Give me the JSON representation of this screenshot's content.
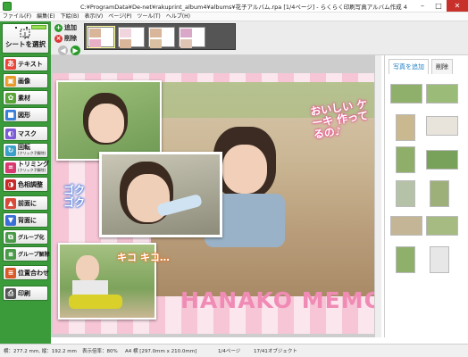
{
  "window": {
    "title": "C:¥ProgramData¥De-net¥rakuprint_album4¥albums¥花子アルバム.rpa [1/4ページ] - らくらく印刷写真アルバム作成 4",
    "controls": [
      "–",
      "□",
      "✕"
    ]
  },
  "menu": [
    "ファイル(F)",
    "編集(E)",
    "下絵(B)",
    "表示(V)",
    "ページ(P)",
    "ツール(T)",
    "ヘルプ(H)"
  ],
  "sidebar": {
    "select_label": "シートを選択",
    "tools": [
      {
        "label": "テキスト",
        "icon": "text-icon",
        "color": "#e8473a",
        "glyph": "あ"
      },
      {
        "label": "画像",
        "icon": "image-icon",
        "color": "#e89a2a",
        "glyph": "▣"
      },
      {
        "label": "素材",
        "icon": "material-icon",
        "color": "#59a53a",
        "glyph": "✿"
      },
      {
        "label": "図形",
        "icon": "shape-icon",
        "color": "#3a7fd8",
        "glyph": "■"
      },
      {
        "label": "マスク",
        "icon": "mask-icon",
        "color": "#7b5bd6",
        "glyph": "◐"
      },
      {
        "label": "回転",
        "sub": "(クリック子解除)",
        "icon": "rotate-icon",
        "color": "#3aa0c8",
        "glyph": "↻"
      },
      {
        "label": "トリミング",
        "sub": "(クリック子解除)",
        "icon": "trim-icon",
        "color": "#d83a6f",
        "glyph": "⌗"
      },
      {
        "label": "色相調整",
        "icon": "hue-icon",
        "color": "#c82a2a",
        "glyph": "◑"
      },
      {
        "label": "前面に",
        "icon": "front-icon",
        "color": "#d84a3a",
        "glyph": "▲"
      },
      {
        "label": "背面に",
        "icon": "back-icon",
        "color": "#3a6fd8",
        "glyph": "▼"
      },
      {
        "label": "グループ化",
        "icon": "group-icon",
        "color": "#4a9a4a",
        "glyph": "⧉"
      },
      {
        "label": "グループ解除",
        "icon": "ungroup-icon",
        "color": "#4a9a4a",
        "glyph": "⧈"
      },
      {
        "label": "位置合わせ",
        "icon": "align-icon",
        "color": "#d85a2a",
        "glyph": "≡"
      },
      {
        "label": "印刷",
        "icon": "print-icon",
        "color": "#555555",
        "glyph": "⎙"
      }
    ]
  },
  "toolbar": {
    "add_label": "追加",
    "delete_label": "削除"
  },
  "canvas": {
    "title_text": "HANAKO MEMORY",
    "handwritten_top": "おいしい ケーキ 作ってるの♪",
    "handwritten_left": "ゴク ゴク",
    "handwritten_bottom": "キコ キコ…"
  },
  "right_panel": {
    "tab_add": "写真を追加",
    "tab_delete": "削除"
  },
  "status": {
    "size": "横：277.2 mm, 縦：192.2 mm",
    "zoom": "表示倍率：80%",
    "paper": "A4 横 [297.0mm x 210.0mm]",
    "page": "1/4ページ",
    "objects": "17/41オブジェクト"
  },
  "colors": {
    "sidebar_green": "#3b9b3b",
    "title_pink": "#f08bb5",
    "accent_blue": "#1c7fc4"
  }
}
